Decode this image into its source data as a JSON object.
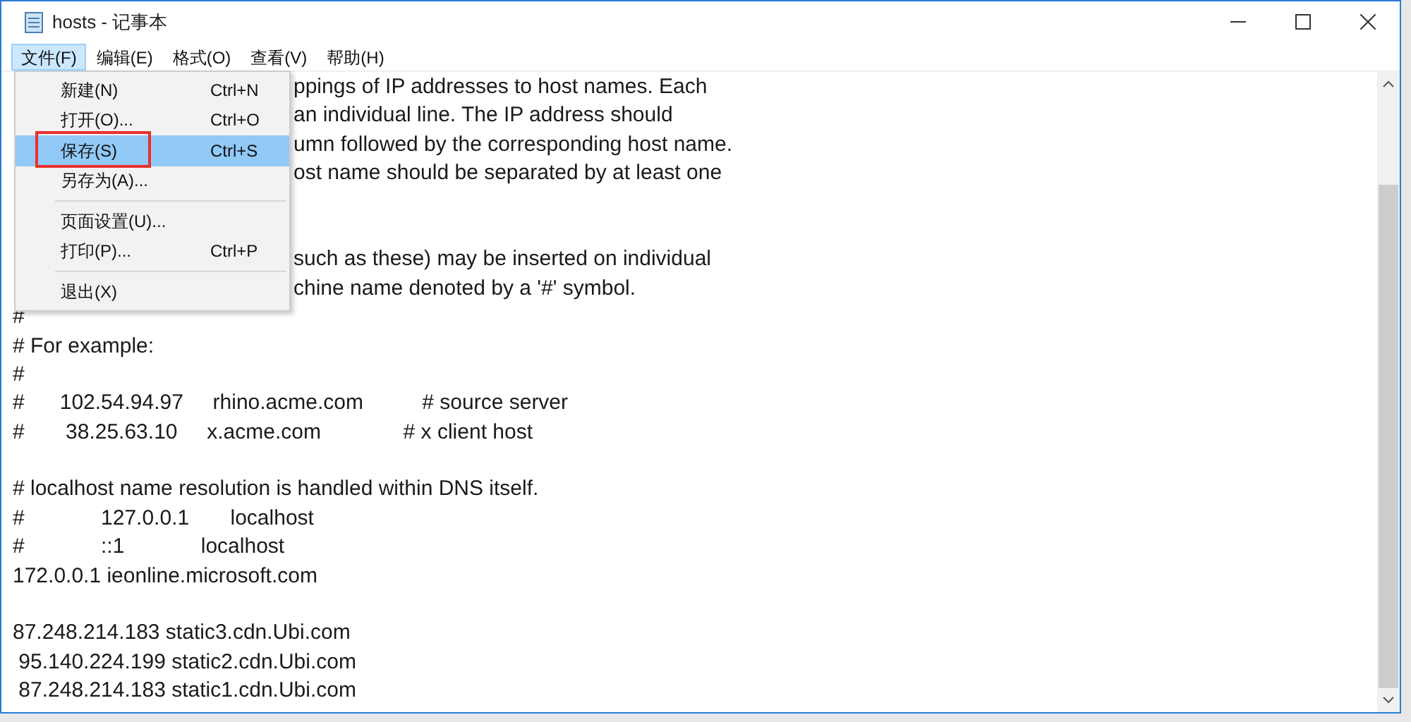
{
  "window": {
    "title": "hosts - 记事本"
  },
  "menubar": [
    {
      "label": "文件(F)",
      "selected": true
    },
    {
      "label": "编辑(E)",
      "selected": false
    },
    {
      "label": "格式(O)",
      "selected": false
    },
    {
      "label": "查看(V)",
      "selected": false
    },
    {
      "label": "帮助(H)",
      "selected": false
    }
  ],
  "menu": {
    "items": [
      {
        "kind": "item",
        "label": "新建(N)",
        "shortcut": "Ctrl+N",
        "selected": false,
        "highlighted": false
      },
      {
        "kind": "item",
        "label": "打开(O)...",
        "shortcut": "Ctrl+O",
        "selected": false,
        "highlighted": false
      },
      {
        "kind": "item",
        "label": "保存(S)",
        "shortcut": "Ctrl+S",
        "selected": true,
        "highlighted": true
      },
      {
        "kind": "item",
        "label": "另存为(A)...",
        "selected": false,
        "highlighted": false
      },
      {
        "kind": "separator"
      },
      {
        "kind": "item",
        "label": "页面设置(U)...",
        "selected": false,
        "highlighted": false
      },
      {
        "kind": "item",
        "label": "打印(P)...",
        "shortcut": "Ctrl+P",
        "selected": false,
        "highlighted": false
      },
      {
        "kind": "separator"
      },
      {
        "kind": "item",
        "label": "退出(X)",
        "selected": false,
        "highlighted": false
      }
    ]
  },
  "editor": {
    "lines": [
      {
        "kind": "partial",
        "text": "ppings of IP addresses to host names. Each"
      },
      {
        "kind": "partial",
        "text": "an individual line. The IP address should"
      },
      {
        "kind": "partial",
        "text": "umn followed by the corresponding host name."
      },
      {
        "kind": "partial",
        "text": "ost name should be separated by at least one"
      },
      {
        "kind": "blank"
      },
      {
        "kind": "blank"
      },
      {
        "kind": "partial",
        "text": "such as these) may be inserted on individual"
      },
      {
        "kind": "partial",
        "text": "chine name denoted by a '#' symbol."
      },
      {
        "kind": "full",
        "text": "#"
      },
      {
        "kind": "full",
        "text": "# For example:"
      },
      {
        "kind": "full",
        "text": "#"
      },
      {
        "kind": "full",
        "text": "#      102.54.94.97     rhino.acme.com          # source server"
      },
      {
        "kind": "full",
        "text": "#       38.25.63.10     x.acme.com              # x client host"
      },
      {
        "kind": "blank"
      },
      {
        "kind": "full",
        "text": "# localhost name resolution is handled within DNS itself."
      },
      {
        "kind": "full",
        "text": "#             127.0.0.1       localhost"
      },
      {
        "kind": "full",
        "text": "#             ::1             localhost"
      },
      {
        "kind": "full",
        "text": "172.0.0.1 ieonline.microsoft.com"
      },
      {
        "kind": "blank"
      },
      {
        "kind": "full",
        "text": "87.248.214.183 static3.cdn.Ubi.com"
      },
      {
        "kind": "full",
        "text": " 95.140.224.199 static2.cdn.Ubi.com"
      },
      {
        "kind": "full",
        "text": " 87.248.214.183 static1.cdn.Ubi.com"
      }
    ]
  }
}
